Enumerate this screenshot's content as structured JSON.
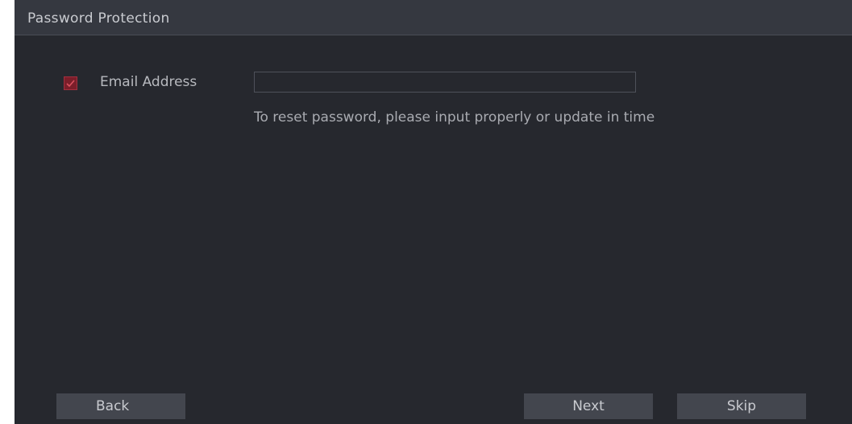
{
  "dialog": {
    "title": "Password Protection"
  },
  "email": {
    "label": "Email Address",
    "value": "",
    "placeholder": "",
    "checked": true,
    "hint": "To reset password, please input properly or update in time"
  },
  "buttons": {
    "back": "Back",
    "next": "Next",
    "skip": "Skip"
  },
  "colors": {
    "background": "#26282e",
    "titlebar": "#353840",
    "checkbox": "#7b1e2a",
    "button": "#43464e"
  }
}
